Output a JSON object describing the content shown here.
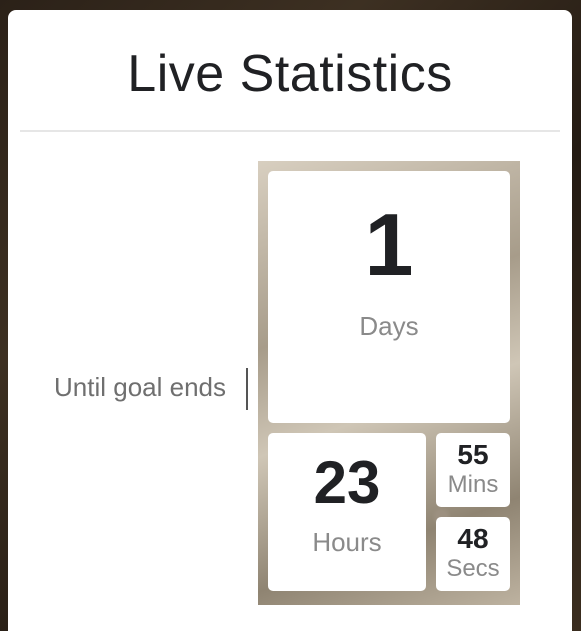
{
  "widget": {
    "title": "Live Statistics",
    "label": "Until goal ends"
  },
  "countdown": {
    "days": {
      "value": "1",
      "unit": "Days"
    },
    "hours": {
      "value": "23",
      "unit": "Hours"
    },
    "minutes": {
      "value": "55",
      "unit": "Mins"
    },
    "seconds": {
      "value": "48",
      "unit": "Secs"
    }
  },
  "colors": {
    "title": "#202124",
    "unit_text": "#8a8a8a",
    "label_text": "#6f6f6f",
    "card_bg": "#ffffff"
  }
}
